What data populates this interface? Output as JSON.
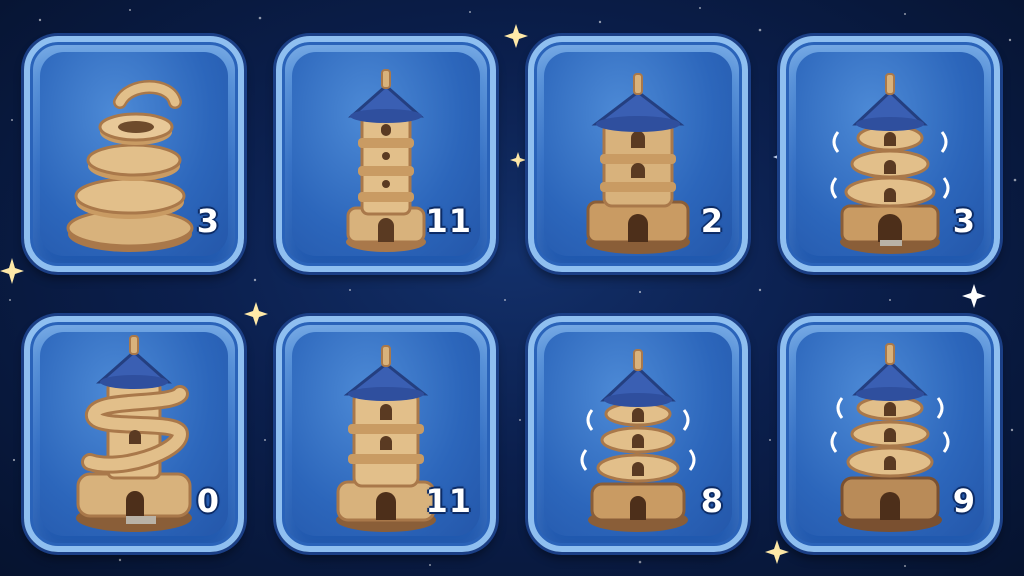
{
  "palette": {
    "background": "#0b1f4d",
    "tile_fill": "#2f6cc3",
    "tile_border": "#8fbff0",
    "sand": "#d8b27c",
    "sand_dark": "#a9784a",
    "roof": "#3a5fb3",
    "count_text": "#ffffff"
  },
  "tiles": [
    {
      "item": "sand-spiral",
      "count": "3"
    },
    {
      "item": "sand-tower-slim",
      "count": "11"
    },
    {
      "item": "sand-tower-wide",
      "count": "2"
    },
    {
      "item": "sand-tower-wobbly",
      "count": "3"
    },
    {
      "item": "sand-tower-spiral-wrapped",
      "count": "0"
    },
    {
      "item": "sand-tower-tall",
      "count": "11"
    },
    {
      "item": "sand-tower-shaking",
      "count": "8"
    },
    {
      "item": "sand-tower-shaking-large",
      "count": "9"
    }
  ]
}
